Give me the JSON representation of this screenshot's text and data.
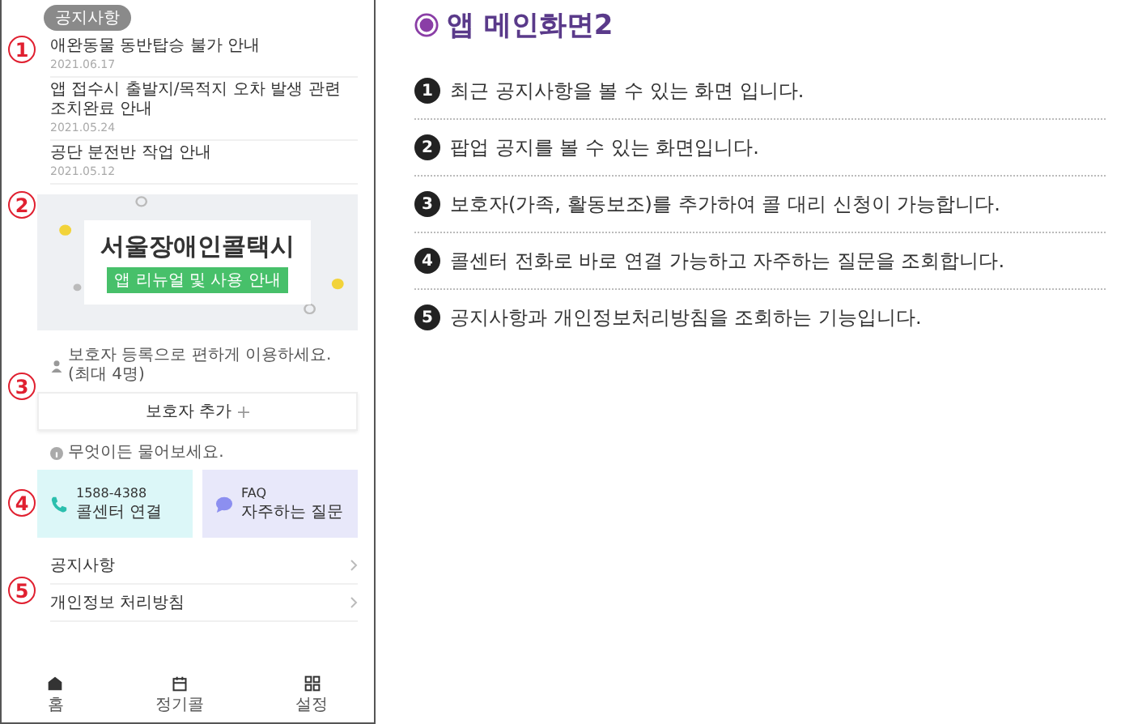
{
  "phone": {
    "notice_badge": "공지사항",
    "notices": [
      {
        "title": "애완동물 동반탑승 불가 안내",
        "date": "2021.06.17"
      },
      {
        "title": "앱 접수시 출발지/목적지 오차 발생 관련 조치완료 안내",
        "date": "2021.05.24"
      },
      {
        "title": "공단 분전반 작업 안내",
        "date": "2021.05.12"
      }
    ],
    "banner": {
      "title": "서울장애인콜택시",
      "button": "앱 리뉴얼 및 사용 안내"
    },
    "guardian_hint": "보호자 등록으로 편하게 이용하세요. (최대 4명)",
    "guardian_button": "보호자 추가",
    "help_hint": "무엇이든 물어보세요.",
    "help_cards": [
      {
        "kind": "call",
        "line1": "1588-4388",
        "line2": "콜센터 연결"
      },
      {
        "kind": "faq",
        "line1": "FAQ",
        "line2": "자주하는 질문"
      }
    ],
    "menu": [
      "공지사항",
      "개인정보 처리방침"
    ],
    "tabs": [
      {
        "kind": "home",
        "label": "홈"
      },
      {
        "kind": "calendar",
        "label": "정기콜"
      },
      {
        "kind": "grid",
        "label": "설정"
      }
    ],
    "markers": [
      "1",
      "2",
      "3",
      "4",
      "5"
    ]
  },
  "description": {
    "title": "앱 메인화면2",
    "items": [
      {
        "number": "1",
        "text": "최근 공지사항을 볼 수 있는 화면 입니다."
      },
      {
        "number": "2",
        "text": "팝업 공지를 볼 수 있는 화면입니다."
      },
      {
        "number": "3",
        "text": "보호자(가족, 활동보조)를 추가하여 콜 대리 신청이 가능합니다."
      },
      {
        "number": "4",
        "text": "콜센터 전화로 바로 연결 가능하고 자주하는 질문을 조회합니다."
      },
      {
        "number": "5",
        "text": "공지사항과 개인정보처리방침을 조회하는 기능입니다."
      }
    ]
  }
}
